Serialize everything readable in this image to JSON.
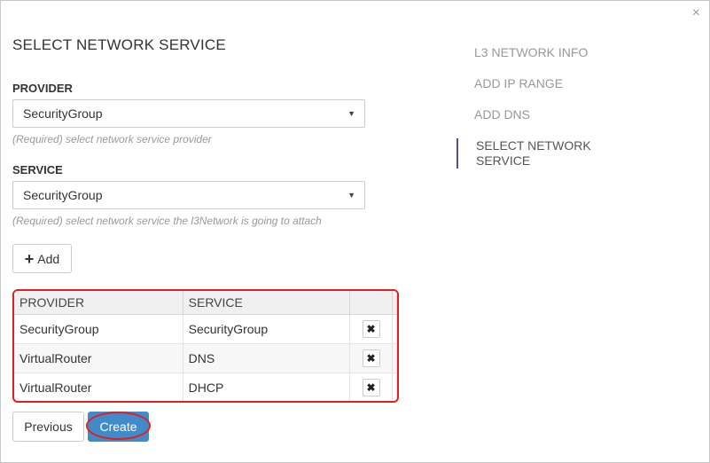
{
  "dialog": {
    "title": "SELECT NETWORK SERVICE",
    "close_glyph": "×"
  },
  "provider": {
    "label": "PROVIDER",
    "value": "SecurityGroup",
    "hint": "(Required) select network service provider"
  },
  "service": {
    "label": "SERVICE",
    "value": "SecurityGroup",
    "hint": "(Required) select network service the l3Network is going to attach"
  },
  "add_button": {
    "icon": "plus-icon",
    "label": "Add"
  },
  "table": {
    "headers": [
      "PROVIDER",
      "SERVICE"
    ],
    "rows": [
      {
        "provider": "SecurityGroup",
        "service": "SecurityGroup",
        "delete_icon": "close-icon"
      },
      {
        "provider": "VirtualRouter",
        "service": "DNS",
        "delete_icon": "close-icon"
      },
      {
        "provider": "VirtualRouter",
        "service": "DHCP",
        "delete_icon": "close-icon"
      }
    ]
  },
  "footer": {
    "previous_label": "Previous",
    "create_label": "Create"
  },
  "steps": [
    {
      "label": "L3 NETWORK INFO",
      "active": false
    },
    {
      "label": "ADD IP RANGE",
      "active": false
    },
    {
      "label": "ADD DNS",
      "active": false
    },
    {
      "label": "SELECT NETWORK SERVICE",
      "active": true
    }
  ],
  "colors": {
    "primary": "#428bca",
    "highlight": "#e02020",
    "active_step_bar": "#5a4a8a"
  }
}
